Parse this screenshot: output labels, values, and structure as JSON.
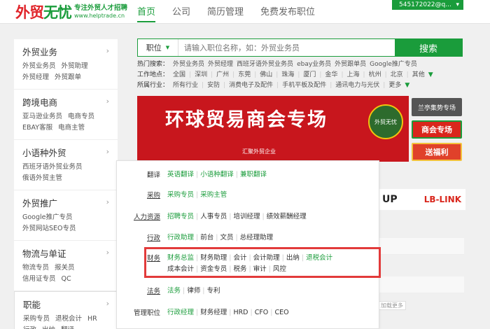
{
  "header": {
    "logo_main": "外贸",
    "logo_main2": "无忧",
    "logo_tagline": "专注外贸人才招聘",
    "logo_url": "www.helptrade.cn",
    "nav": [
      "首页",
      "公司",
      "简历管理",
      "免费发布职位"
    ],
    "user": "545172022@q...",
    "user_caret": "▾"
  },
  "sidebar": [
    {
      "title": "外贸业务",
      "links": [
        "外贸业务员",
        "外贸助理",
        "外贸经理",
        "外贸跟单"
      ]
    },
    {
      "title": "跨境电商",
      "links": [
        "亚马逊业务员",
        "电商专员",
        "EBAY客服",
        "电商主管"
      ]
    },
    {
      "title": "小语种外贸",
      "links": [
        "西班牙语外贸业务员",
        "俄语外贸主管"
      ]
    },
    {
      "title": "外贸推广",
      "links": [
        "Google推广专员",
        "外贸网站SEO专员"
      ]
    },
    {
      "title": "物流与单证",
      "links": [
        "物流专员",
        "报关员",
        "信用证专员",
        "QC"
      ]
    },
    {
      "title": "职能",
      "links": [
        "采购专员",
        "退税会计",
        "HR",
        "行政",
        "出纳",
        "翻译"
      ]
    }
  ],
  "search": {
    "type": "职位",
    "placeholder": "请输入职位名称，如：外贸业务员",
    "button": "搜索"
  },
  "filters": {
    "hot_label": "热门搜索：",
    "hot": [
      "外贸业务员",
      "外贸经理",
      "西班牙语外贸业务员",
      "ebay业务员",
      "外贸跟单员",
      "Google推广专员"
    ],
    "loc_label": "工作地点：",
    "loc": [
      "全国",
      "深圳",
      "广州",
      "东莞",
      "佛山",
      "珠海",
      "厦门",
      "金华",
      "上海",
      "杭州",
      "北京"
    ],
    "loc_more": "其他",
    "ind_label": "所属行业：",
    "ind": [
      "所有行业",
      "安防",
      "消费电子及配件",
      "手机平板及配件",
      "通讯电力与光伏"
    ],
    "ind_more": "更多"
  },
  "banner": {
    "title": "环球贸易商会专场",
    "badge": "外贸无忧",
    "foot": "汇聚外贸企业"
  },
  "side_buttons": [
    "兰亭集势专场",
    "商会专场",
    "送福利"
  ],
  "brands": [
    "UP",
    "LB-LINK"
  ],
  "small_tag": "加载更多",
  "popup": {
    "rows": [
      {
        "label": "翻译",
        "links": [
          "英语翻译",
          "小语种翻译",
          "兼职翻译"
        ]
      },
      {
        "label": "采购",
        "links": [
          "采购专员",
          "采购主管"
        ]
      },
      {
        "label": "人力资源",
        "links": [
          "招聘专员",
          "人事专员",
          "培训经理",
          "绩效薪酬经理"
        ]
      },
      {
        "label": "行政",
        "links": [
          "行政助理",
          "前台",
          "文员",
          "总经理助理"
        ]
      },
      {
        "label": "财务",
        "links": [
          "财务总监",
          "财务助理",
          "会计",
          "会计助理",
          "出纳",
          "退税会计",
          "成本会计",
          "资金专员",
          "税务",
          "审计",
          "风控"
        ]
      },
      {
        "label": "法务",
        "links": [
          "法务",
          "律师",
          "专利"
        ]
      },
      {
        "label": "管理职位",
        "links": [
          "行政经理",
          "财务经理",
          "HRD",
          "CFO",
          "CEO"
        ]
      }
    ]
  },
  "colors": {
    "accent": "#1a9c3b",
    "highlight": "#e23b3b"
  }
}
